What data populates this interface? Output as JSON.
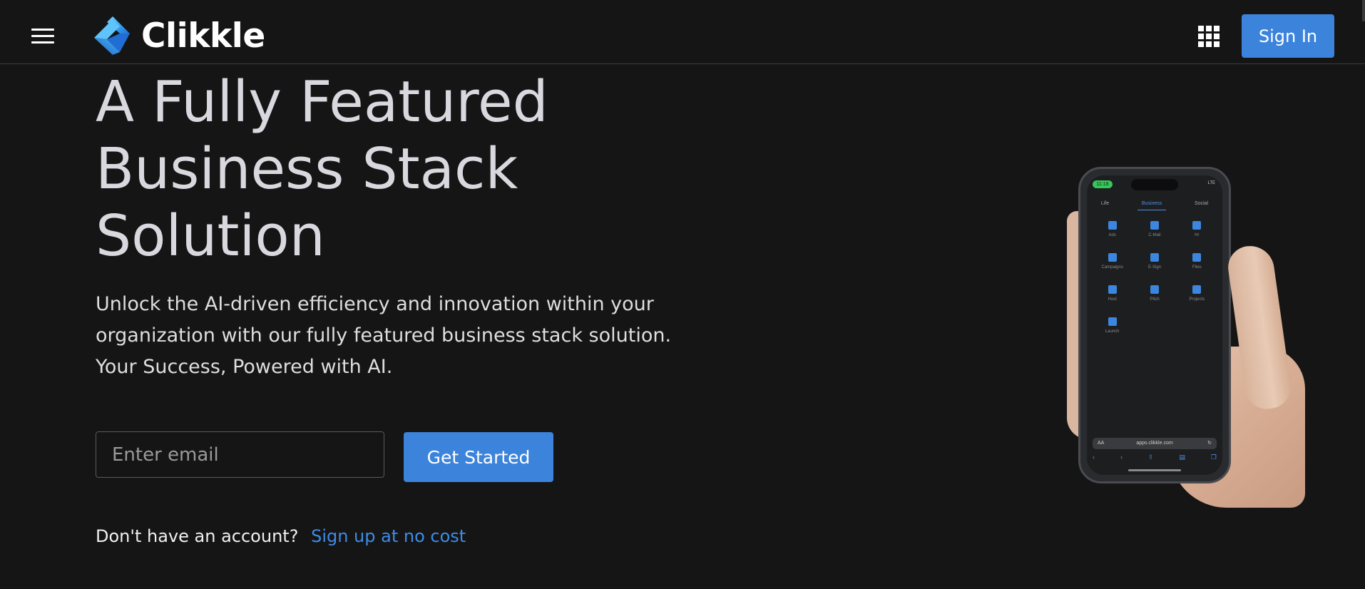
{
  "header": {
    "menu_icon": "hamburger-menu-icon",
    "brand": {
      "name": "Clikkle",
      "logo_icon": "clikkle-logo-icon",
      "logo_colors": [
        "#1f6ed4",
        "#3aa8f2",
        "#7fd3ff"
      ]
    },
    "apps_icon": "apps-grid-icon",
    "sign_in_label": "Sign In"
  },
  "hero": {
    "title_lines": [
      "A Fully Featured",
      "Business Stack",
      "Solution"
    ],
    "description_lines": [
      "Unlock the AI-driven efficiency and innovation within your",
      "organization with our fully featured business stack solution.",
      "Your Success, Powered with AI."
    ],
    "email": {
      "placeholder": "Enter email",
      "value": ""
    },
    "get_started_label": "Get Started",
    "signup": {
      "question": "Don't have an account?",
      "link": "Sign up at no cost"
    }
  },
  "phone": {
    "time": "11:18",
    "status": "LTE",
    "tabs": [
      {
        "label": "Life",
        "active": false
      },
      {
        "label": "Business",
        "active": true
      },
      {
        "label": "Social",
        "active": false
      }
    ],
    "apps": [
      "Ads",
      "C-Mail",
      "Hr",
      "Campaigns",
      "E-Sign",
      "Files",
      "Host",
      "Pitch",
      "Projects",
      "Launch"
    ],
    "url": "apps.clikkle.com",
    "url_text_size": "AA"
  },
  "colors": {
    "background": "#151515",
    "accent": "#3b83db",
    "link": "#3d8ce6",
    "title": "#d8d8de"
  }
}
